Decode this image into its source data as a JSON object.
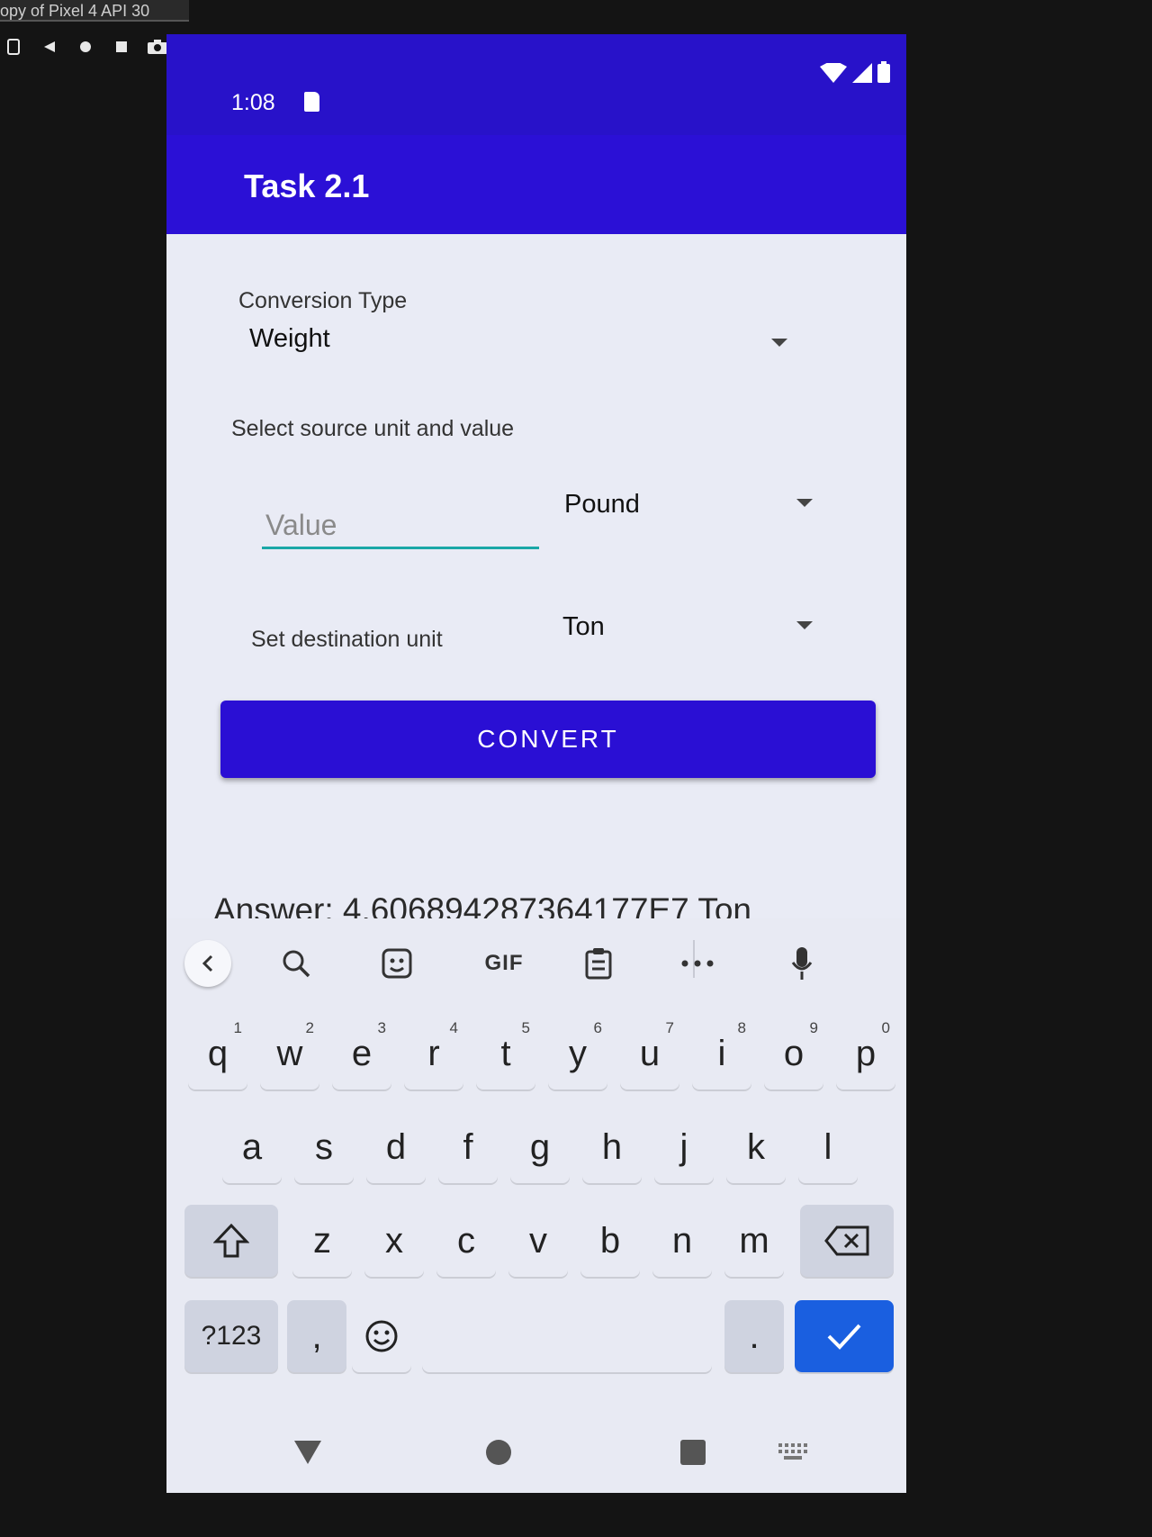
{
  "emulator": {
    "title": "opy of Pixel 4 API 30"
  },
  "status_bar": {
    "time": "1:08",
    "color": "#2812c9"
  },
  "app_bar": {
    "title": "Task 2.1",
    "color": "#2b10d6"
  },
  "form": {
    "conversion_type_label": "Conversion Type",
    "conversion_type_value": "Weight",
    "source_label": "Select source unit and value",
    "value_placeholder": "Value",
    "source_unit": "Pound",
    "destination_label": "Set destination unit",
    "destination_unit": "Ton",
    "convert_label": "CONVERT",
    "answer": "Answer: 4.606894287364177E7 Ton"
  },
  "keyboard": {
    "suggestion_strip": [
      "back-icon",
      "search-icon",
      "sticker-icon",
      "GIF",
      "clipboard-icon",
      "more-icon",
      "mic-icon"
    ],
    "gif_label": "GIF",
    "row1": [
      {
        "key": "q",
        "hint": "1"
      },
      {
        "key": "w",
        "hint": "2"
      },
      {
        "key": "e",
        "hint": "3"
      },
      {
        "key": "r",
        "hint": "4"
      },
      {
        "key": "t",
        "hint": "5"
      },
      {
        "key": "y",
        "hint": "6"
      },
      {
        "key": "u",
        "hint": "7"
      },
      {
        "key": "i",
        "hint": "8"
      },
      {
        "key": "o",
        "hint": "9"
      },
      {
        "key": "p",
        "hint": "0"
      }
    ],
    "row2": [
      "a",
      "s",
      "d",
      "f",
      "g",
      "h",
      "j",
      "k",
      "l"
    ],
    "row3": [
      "z",
      "x",
      "c",
      "v",
      "b",
      "n",
      "m"
    ],
    "symbols_label": "?123",
    "comma": ",",
    "period": ".",
    "accent_color": "#1a5fe0"
  }
}
